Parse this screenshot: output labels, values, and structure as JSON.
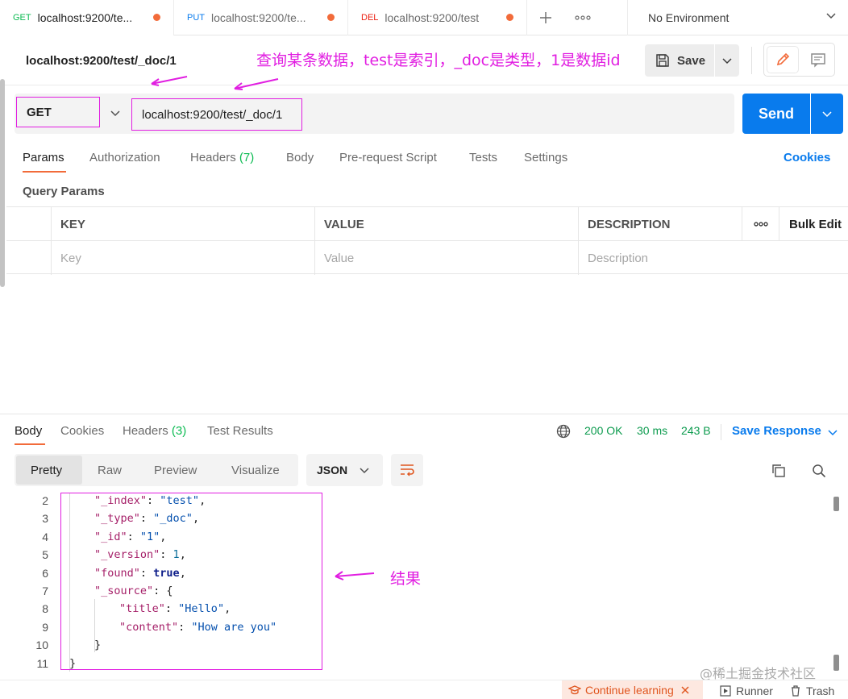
{
  "tabs": [
    {
      "method": "GET",
      "title": "localhost:9200/te..."
    },
    {
      "method": "PUT",
      "title": "localhost:9200/te..."
    },
    {
      "method": "DEL",
      "title": "localhost:9200/test"
    }
  ],
  "environment": "No Environment",
  "request": {
    "name": "localhost:9200/test/_doc/1",
    "method": "GET",
    "url": "localhost:9200/test/_doc/1",
    "save_label": "Save",
    "send_label": "Send"
  },
  "annotations": {
    "top": "查询某条数据，test是索引，_doc是类型，1是数据id",
    "result": "结果"
  },
  "request_tabs": {
    "params": "Params",
    "authorization": "Authorization",
    "headers": "Headers",
    "headers_count": "(7)",
    "body": "Body",
    "prerequest": "Pre-request Script",
    "tests": "Tests",
    "settings": "Settings",
    "cookies": "Cookies"
  },
  "query_params": {
    "title": "Query Params",
    "columns": [
      "KEY",
      "VALUE",
      "DESCRIPTION"
    ],
    "more": "ooo",
    "bulk_edit": "Bulk Edit",
    "placeholders": [
      "Key",
      "Value",
      "Description"
    ]
  },
  "response_tabs": {
    "body": "Body",
    "cookies": "Cookies",
    "headers": "Headers",
    "headers_count": "(3)",
    "test_results": "Test Results"
  },
  "response_status": {
    "status": "200 OK",
    "time": "30 ms",
    "size": "243 B",
    "save_response": "Save Response"
  },
  "view_modes": [
    "Pretty",
    "Raw",
    "Preview",
    "Visualize"
  ],
  "format": "JSON",
  "code_lines": [
    {
      "n": "2",
      "key": "\"_index\"",
      "val": "\"test\"",
      "type": "s",
      "indent": 1,
      "tail": ","
    },
    {
      "n": "3",
      "key": "\"_type\"",
      "val": "\"_doc\"",
      "type": "s",
      "indent": 1,
      "tail": ","
    },
    {
      "n": "4",
      "key": "\"_id\"",
      "val": "\"1\"",
      "type": "s",
      "indent": 1,
      "tail": ","
    },
    {
      "n": "5",
      "key": "\"_version\"",
      "val": "1",
      "type": "n",
      "indent": 1,
      "tail": ","
    },
    {
      "n": "6",
      "key": "\"found\"",
      "val": "true",
      "type": "b",
      "indent": 1,
      "tail": ","
    },
    {
      "n": "7",
      "key": "\"_source\"",
      "val": "{",
      "type": "p",
      "indent": 1,
      "tail": ""
    },
    {
      "n": "8",
      "key": "\"title\"",
      "val": "\"Hello\"",
      "type": "s",
      "indent": 2,
      "tail": ","
    },
    {
      "n": "9",
      "key": "\"content\"",
      "val": "\"How are you\"",
      "type": "s",
      "indent": 2,
      "tail": ""
    },
    {
      "n": "10",
      "key": "",
      "val": "}",
      "type": "p",
      "indent": 1,
      "tail": ""
    },
    {
      "n": "11",
      "key": "",
      "val": "}",
      "type": "p",
      "indent": 0,
      "tail": ""
    }
  ],
  "footer": {
    "continue_learning": "Continue learning",
    "runner": "Runner",
    "trash": "Trash"
  },
  "watermark": "@稀土掘金技术社区",
  "colors": {
    "accent": "#097bed",
    "tab_underline": "#f26b3a",
    "annotation": "#e11ee1",
    "status_ok": "#0c9b4e"
  }
}
